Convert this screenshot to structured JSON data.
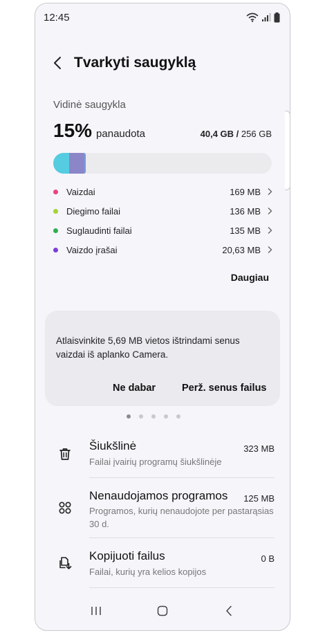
{
  "status_bar": {
    "time": "12:45"
  },
  "header": {
    "title": "Tvarkyti saugyklą"
  },
  "storage": {
    "section_label": "Vidinė saugykla",
    "percent_used": "15%",
    "used_word": "panaudota",
    "used_amount": "40,4 GB",
    "separator": " / ",
    "total_amount": "256 GB",
    "used_fraction": 0.15,
    "segment_colors": [
      "#55cce0",
      "#8a86c8",
      "#7d93d8"
    ],
    "categories": [
      {
        "label": "Vaizdai",
        "size": "169 MB",
        "color": "#e8467c"
      },
      {
        "label": "Diegimo failai",
        "size": "136 MB",
        "color": "#a6d334"
      },
      {
        "label": "Suglaudinti failai",
        "size": "135 MB",
        "color": "#2fae4f"
      },
      {
        "label": "Vaizdo įrašai",
        "size": "20,63 MB",
        "color": "#7b3fd6"
      }
    ],
    "more_label": "Daugiau"
  },
  "suggestion_card": {
    "text": "Atlaisvinkite 5,69 MB vietos ištrindami senus vaizdai iš aplanko Camera.",
    "dismiss_label": "Ne dabar",
    "review_label": "Perž. senus failus",
    "page_count": 5,
    "active_page": 1
  },
  "items": [
    {
      "title": "Šiukšlinė",
      "size": "323 MB",
      "description": "Failai įvairių programų šiukšlinėje",
      "icon": "trash-icon"
    },
    {
      "title": "Nenaudojamos programos",
      "size": "125 MB",
      "description": "Programos, kurių nenaudojote per pastarąsias 30 d.",
      "icon": "apps-grid-icon"
    },
    {
      "title": "Kopijuoti failus",
      "size": "0 B",
      "description": "Failai, kurių yra kelios kopijos",
      "icon": "duplicate-files-icon"
    }
  ]
}
